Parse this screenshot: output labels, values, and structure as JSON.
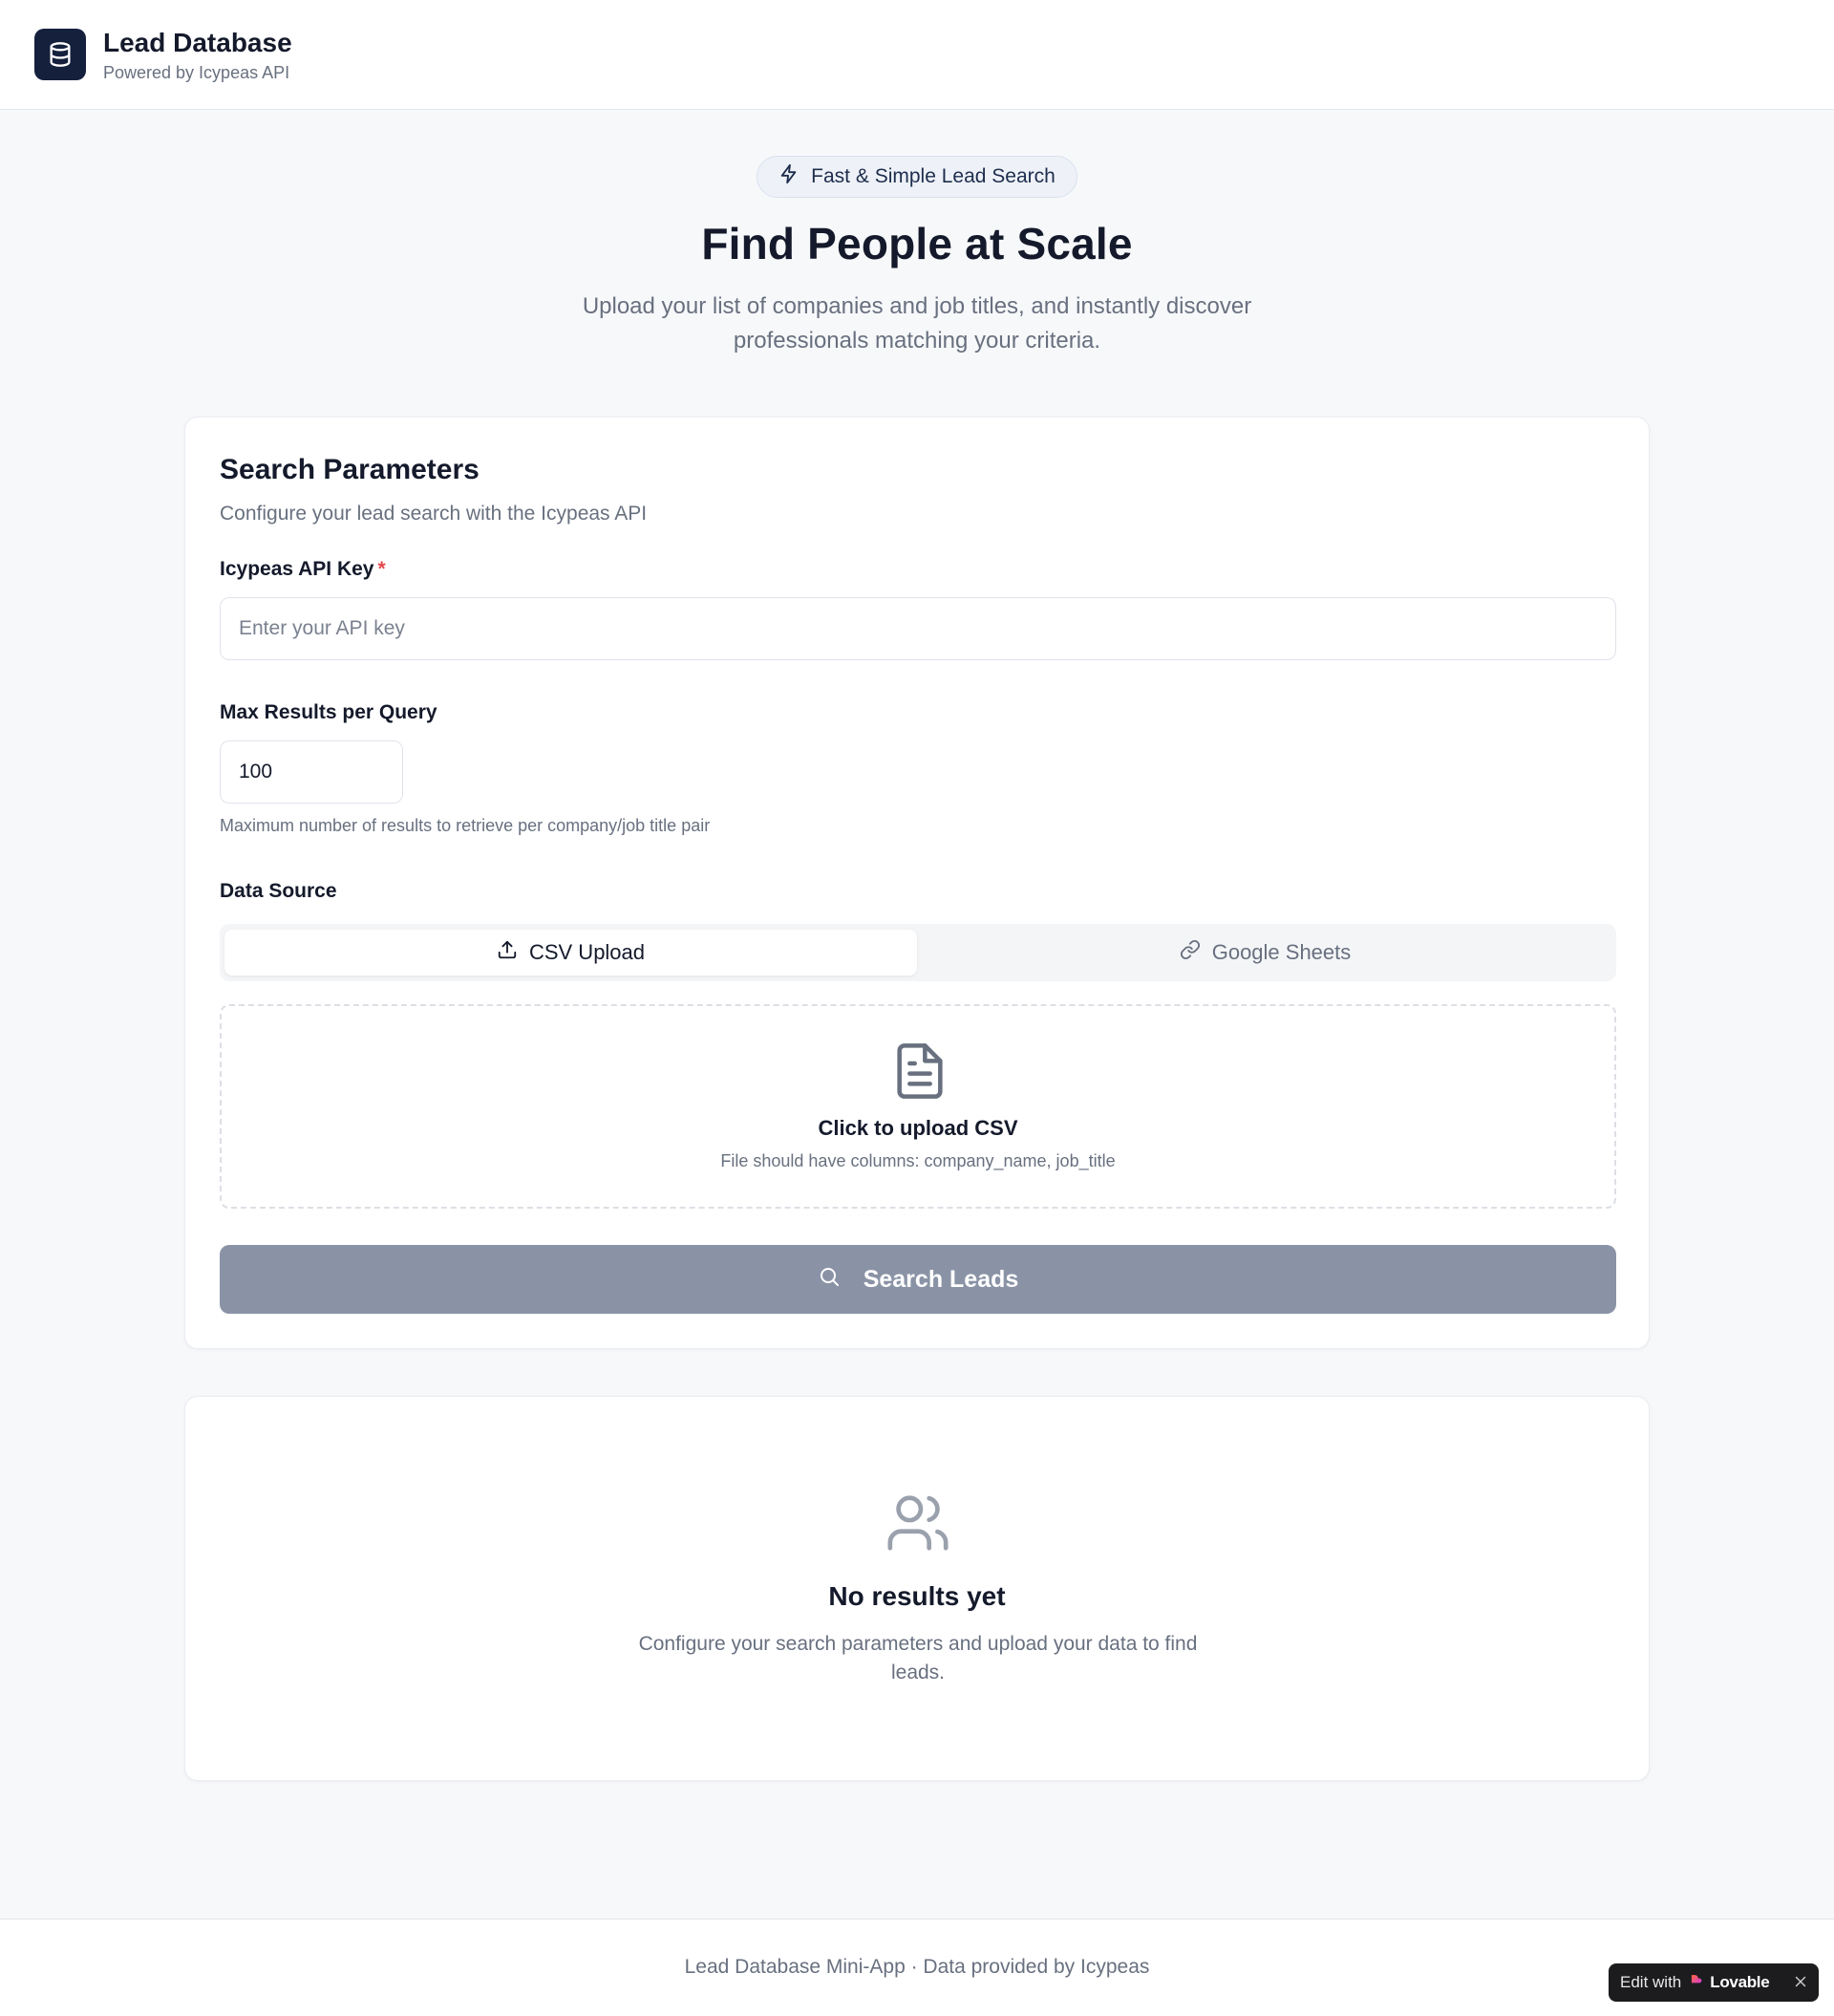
{
  "header": {
    "title": "Lead Database",
    "subtitle": "Powered by Icypeas API",
    "logo_icon": "database-icon"
  },
  "hero": {
    "badge": "Fast & Simple Lead Search",
    "badge_icon": "lightning-icon",
    "title": "Find People at Scale",
    "description": "Upload your list of companies and job titles, and instantly discover professionals matching your criteria."
  },
  "search_params": {
    "title": "Search Parameters",
    "subtitle": "Configure your lead search with the Icypeas API",
    "api_key": {
      "label": "Icypeas API Key",
      "required_mark": "*",
      "placeholder": "Enter your API key",
      "value": ""
    },
    "max_results": {
      "label": "Max Results per Query",
      "value": "100",
      "help": "Maximum number of results to retrieve per company/job title pair"
    },
    "data_source": {
      "label": "Data Source",
      "tabs": [
        {
          "label": "CSV Upload",
          "icon": "upload-icon",
          "active": true
        },
        {
          "label": "Google Sheets",
          "icon": "link-icon",
          "active": false
        }
      ]
    },
    "upload": {
      "icon": "file-text-icon",
      "title": "Click to upload CSV",
      "hint": "File should have columns: company_name, job_title"
    },
    "search_button": {
      "label": "Search Leads",
      "icon": "search-icon"
    }
  },
  "results": {
    "icon": "users-icon",
    "title": "No results yet",
    "description": "Configure your search parameters and upload your data to find leads."
  },
  "footer": {
    "text": "Lead Database Mini-App · Data provided by Icypeas",
    "edit_badge": {
      "prefix": "Edit with",
      "brand": "Lovable",
      "close_icon": "close-icon"
    }
  },
  "colors": {
    "brand_dark": "#15203d",
    "button_disabled": "#8a93a6",
    "required": "#e5484d",
    "muted_text": "#68707f",
    "page_bg": "#f7f8fa"
  }
}
